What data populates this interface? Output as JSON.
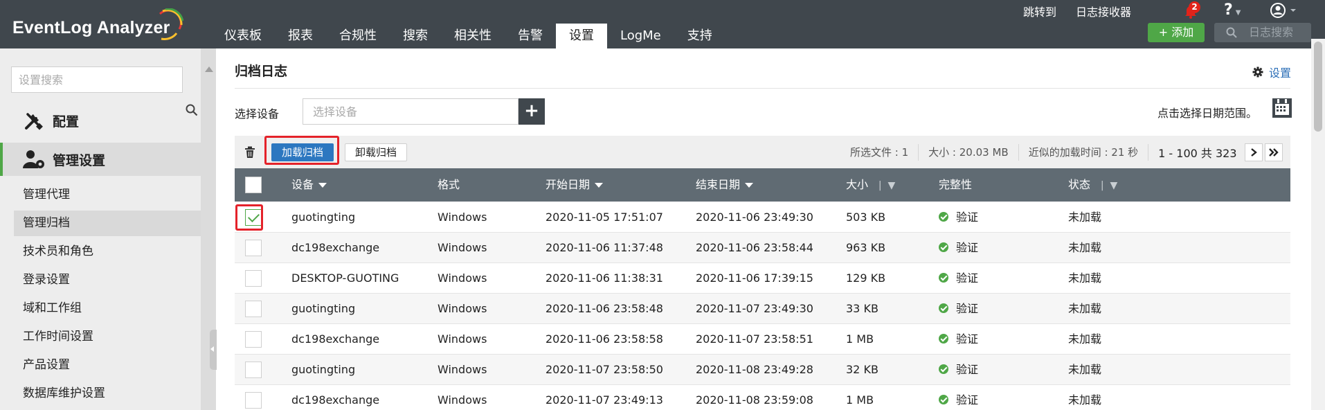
{
  "header": {
    "logo_text": "EventLog Analyzer",
    "nav_tabs": [
      "仪表板",
      "报表",
      "合规性",
      "搜索",
      "相关性",
      "告警",
      "设置",
      "LogMe",
      "支持"
    ],
    "active_tab": "设置",
    "top_links": {
      "jump_to": "跳转到",
      "log_receiver": "日志接收器"
    },
    "notification_count": "2",
    "help_label": "?",
    "add_button": "+ 添加",
    "log_search_placeholder": "日志搜索",
    "brand_colors": {
      "bar": "#40474d",
      "accent_green": "#4fa747",
      "link_blue": "#2c77c0",
      "highlight_red": "#e4222a"
    }
  },
  "sidebar": {
    "search_placeholder": "设置搜索",
    "section_config": "配置",
    "section_admin": "管理设置",
    "items": [
      {
        "label": "管理代理",
        "active": false
      },
      {
        "label": "管理归档",
        "active": true
      },
      {
        "label": "技术员和角色",
        "active": false
      },
      {
        "label": "登录设置",
        "active": false
      },
      {
        "label": "域和工作组",
        "active": false
      },
      {
        "label": "工作时间设置",
        "active": false
      },
      {
        "label": "产品设置",
        "active": false
      },
      {
        "label": "数据库维护设置",
        "active": false
      }
    ]
  },
  "main": {
    "title": "归档日志",
    "settings_link": "设置",
    "select_device_label": "选择设备",
    "select_device_placeholder": "选择设备",
    "date_range_label": "点击选择日期范围。",
    "toolbar": {
      "load_archive": "加载归档",
      "unload_archive": "卸载归档",
      "selected_files": "所选文件 : 1",
      "size": "大小 : 20.03 MB",
      "approx_load_time": "近似的加载时间 : 21 秒",
      "pagination": "1 - 100 共 323"
    },
    "columns": {
      "device": "设备",
      "format": "格式",
      "start_date": "开始日期",
      "end_date": "结束日期",
      "size": "大小",
      "integrity": "完整性",
      "status": "状态"
    },
    "rows": [
      {
        "checked": true,
        "device": "guotingting",
        "format": "Windows",
        "start": "2020-11-05 17:51:07",
        "end": "2020-11-06 23:49:30",
        "size": "503 KB",
        "integrity": "验证",
        "status": "未加载"
      },
      {
        "checked": false,
        "device": "dc198exchange",
        "format": "Windows",
        "start": "2020-11-06 11:37:48",
        "end": "2020-11-06 23:58:44",
        "size": "963 KB",
        "integrity": "验证",
        "status": "未加载"
      },
      {
        "checked": false,
        "device": "DESKTOP-GUOTING",
        "format": "Windows",
        "start": "2020-11-06 11:38:31",
        "end": "2020-11-06 17:39:15",
        "size": "129 KB",
        "integrity": "验证",
        "status": "未加载"
      },
      {
        "checked": false,
        "device": "guotingting",
        "format": "Windows",
        "start": "2020-11-06 23:58:48",
        "end": "2020-11-07 23:49:30",
        "size": "33 KB",
        "integrity": "验证",
        "status": "未加载"
      },
      {
        "checked": false,
        "device": "dc198exchange",
        "format": "Windows",
        "start": "2020-11-06 23:58:58",
        "end": "2020-11-07 23:58:51",
        "size": "1 MB",
        "integrity": "验证",
        "status": "未加载"
      },
      {
        "checked": false,
        "device": "guotingting",
        "format": "Windows",
        "start": "2020-11-07 23:58:50",
        "end": "2020-11-08 23:49:28",
        "size": "32 KB",
        "integrity": "验证",
        "status": "未加载"
      },
      {
        "checked": false,
        "device": "dc198exchange",
        "format": "Windows",
        "start": "2020-11-07 23:49:13",
        "end": "2020-11-08 23:59:08",
        "size": "1 MB",
        "integrity": "验证",
        "status": "未加载"
      }
    ]
  }
}
